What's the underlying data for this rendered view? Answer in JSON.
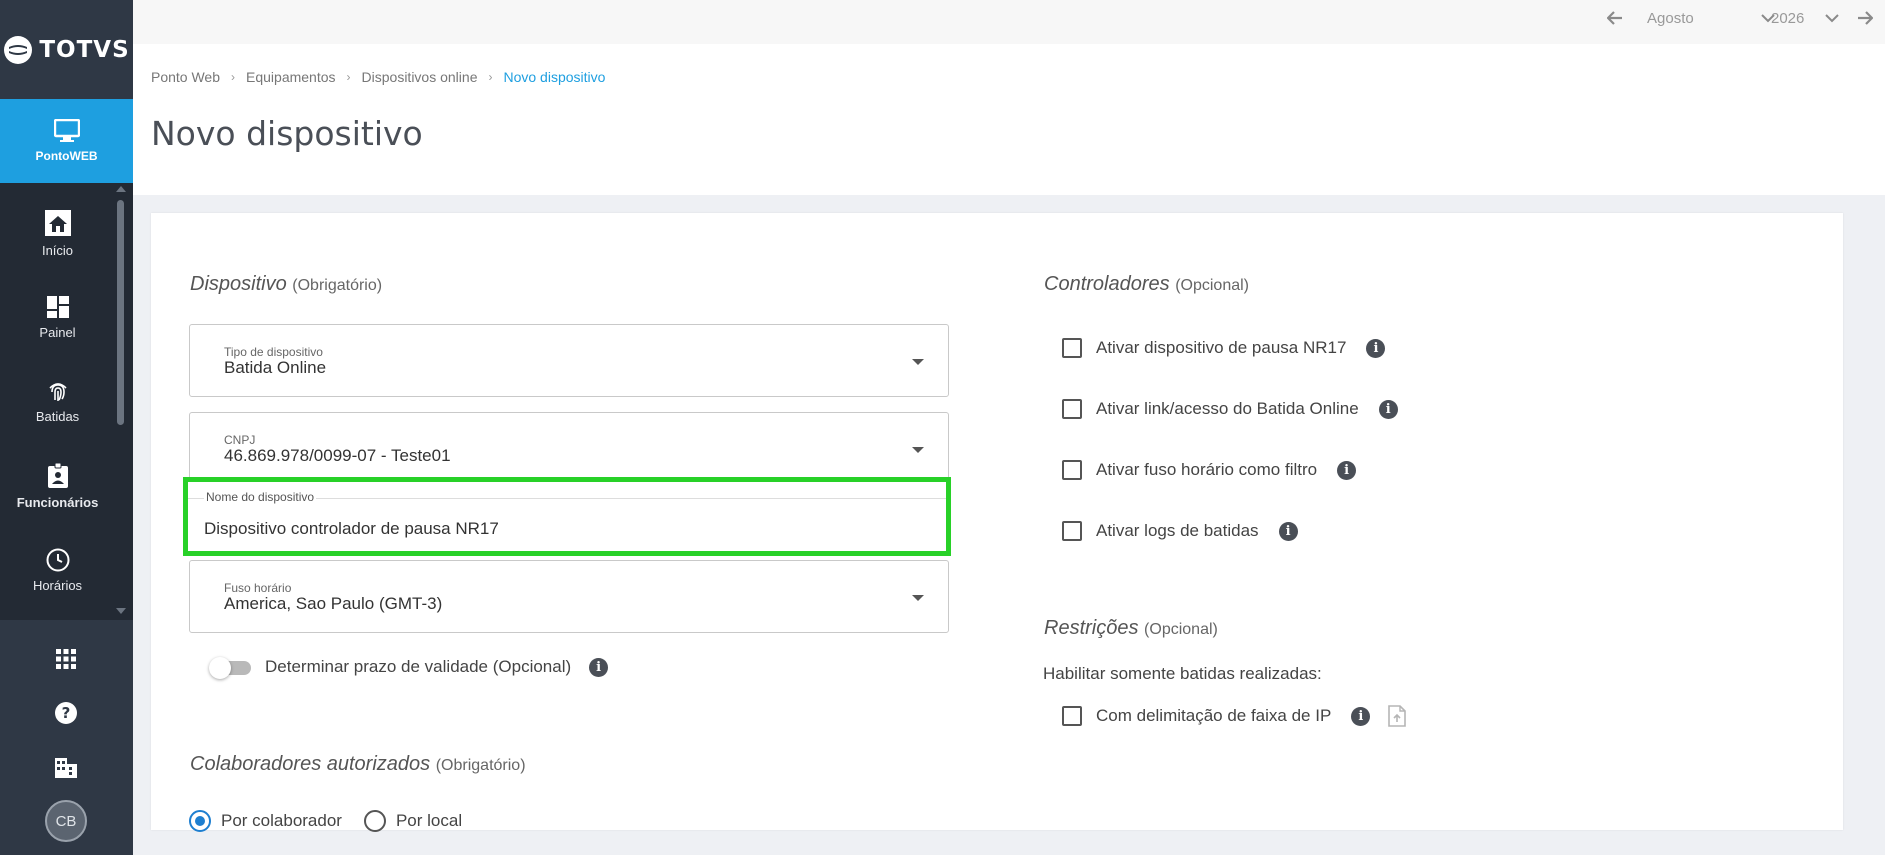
{
  "app": {
    "logo_text": "TOTVS"
  },
  "sidebar": {
    "active": {
      "label": "PontoWEB",
      "icon": "monitor-icon"
    },
    "items": [
      {
        "label": "Início",
        "icon": "home-icon"
      },
      {
        "label": "Painel",
        "icon": "dashboard-icon"
      },
      {
        "label": "Batidas",
        "icon": "fingerprint-icon"
      },
      {
        "label": "Funcionários",
        "icon": "badge-icon"
      },
      {
        "label": "Horários",
        "icon": "clock-icon"
      }
    ],
    "bottom_icons": [
      "apps-grid-icon",
      "help-icon",
      "building-icon"
    ],
    "avatar": "CB"
  },
  "topbar": {
    "month": "Agosto",
    "year": "2026"
  },
  "breadcrumb": [
    "Ponto Web",
    "Equipamentos",
    "Dispositivos online",
    "Novo dispositivo"
  ],
  "page_title": "Novo dispositivo",
  "dispositivo": {
    "title": "Dispositivo",
    "qualifier": "(Obrigatório)",
    "tipo": {
      "label": "Tipo de dispositivo",
      "value": "Batida Online"
    },
    "cnpj": {
      "label": "CNPJ",
      "value": "46.869.978/0099-07 - Teste01"
    },
    "nome": {
      "label": "Nome do dispositivo",
      "value": "Dispositivo controlador de pausa NR17"
    },
    "fuso": {
      "label": "Fuso horário",
      "value": "America, Sao Paulo (GMT-3)"
    },
    "validade_label": "Determinar prazo de validade (Opcional)",
    "validade_on": false
  },
  "colaboradores": {
    "title": "Colaboradores autorizados",
    "qualifier": "(Obrigatório)",
    "options": [
      "Por colaborador",
      "Por local"
    ],
    "selected": "Por colaborador"
  },
  "controladores": {
    "title": "Controladores",
    "qualifier": "(Opcional)",
    "options": [
      "Ativar dispositivo de pausa NR17",
      "Ativar link/acesso do Batida Online",
      "Ativar fuso horário como filtro",
      "Ativar logs de batidas"
    ]
  },
  "restricoes": {
    "title": "Restrições",
    "qualifier": "(Opcional)",
    "subtitle": "Habilitar somente batidas realizadas:",
    "option": "Com delimitação de faixa de IP"
  },
  "colors": {
    "accent": "#1e9fe0",
    "sidebar": "#2f3845",
    "highlight": "#28d128"
  }
}
